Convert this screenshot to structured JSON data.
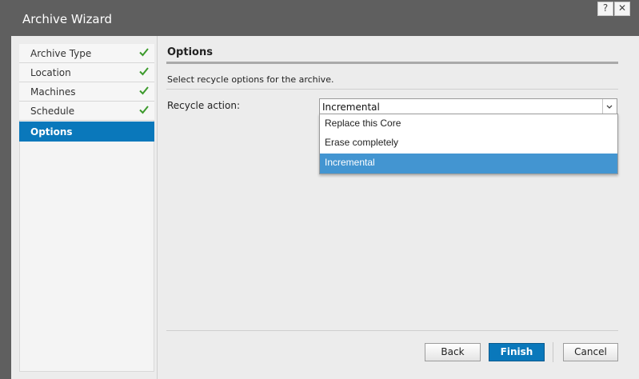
{
  "window": {
    "title": "Archive Wizard",
    "help_label": "?",
    "close_label": "✕"
  },
  "steps": [
    {
      "label": "Archive Type",
      "done": true
    },
    {
      "label": "Location",
      "done": true
    },
    {
      "label": "Machines",
      "done": true
    },
    {
      "label": "Schedule",
      "done": true
    },
    {
      "label": "Options",
      "done": false,
      "active": true
    }
  ],
  "main": {
    "title": "Options",
    "description": "Select recycle options for the archive.",
    "recycle_label": "Recycle action:",
    "recycle_value": "Incremental",
    "options": [
      "Replace this Core",
      "Erase completely",
      "Incremental"
    ],
    "selected_option": "Incremental"
  },
  "buttons": {
    "back": "Back",
    "finish": "Finish",
    "cancel": "Cancel"
  },
  "colors": {
    "accent": "#0a78bb",
    "selected_option": "#4395d1",
    "check": "#3c9a2c",
    "titlebar": "#5f5f5f"
  }
}
